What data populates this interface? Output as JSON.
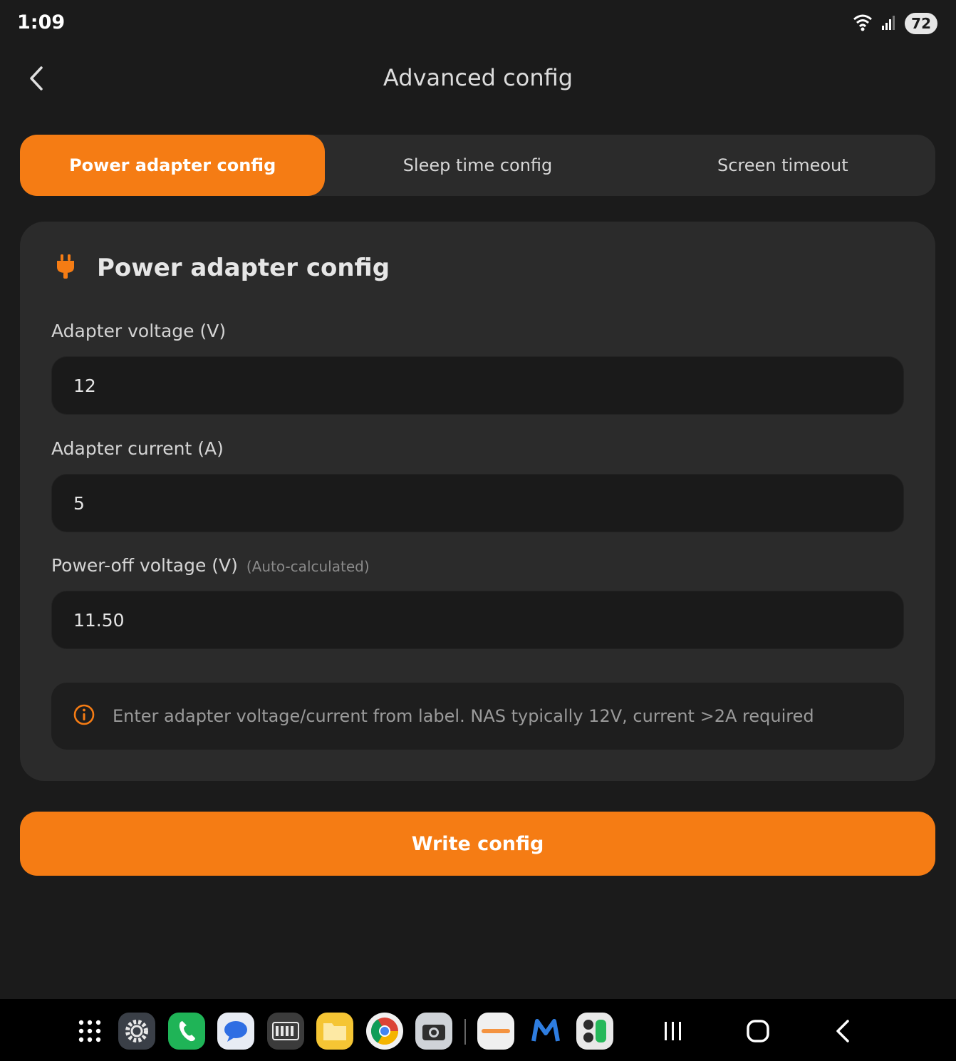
{
  "status_bar": {
    "time": "1:09",
    "battery": "72"
  },
  "app_bar": {
    "title": "Advanced config"
  },
  "tabs": [
    {
      "label": "Power adapter config",
      "active": true
    },
    {
      "label": "Sleep time config",
      "active": false
    },
    {
      "label": "Screen timeout",
      "active": false
    }
  ],
  "card": {
    "icon": "plug-icon",
    "title": "Power adapter config",
    "fields": [
      {
        "label": "Adapter voltage (V)",
        "note": "",
        "value": "12"
      },
      {
        "label": "Adapter current (A)",
        "note": "",
        "value": "5"
      },
      {
        "label": "Power-off voltage (V)",
        "note": "(Auto-calculated)",
        "value": "11.50"
      }
    ],
    "info": "Enter adapter voltage/current from label. NAS typically 12V, current >2A required"
  },
  "primary_button": {
    "label": "Write config"
  },
  "nav_bar": {
    "dock": [
      "app-drawer-icon",
      "settings-icon",
      "phone-icon",
      "messages-icon",
      "keyboard-icon",
      "files-icon",
      "chrome-icon",
      "camera-icon",
      "app-icon",
      "m-app-icon",
      "calculator-icon"
    ],
    "system": [
      "recents-icon",
      "home-icon",
      "back-icon"
    ]
  },
  "colors": {
    "accent": "#f57c14",
    "background": "#1b1b1b",
    "card": "#2b2b2b",
    "input": "#1a1a1a"
  }
}
